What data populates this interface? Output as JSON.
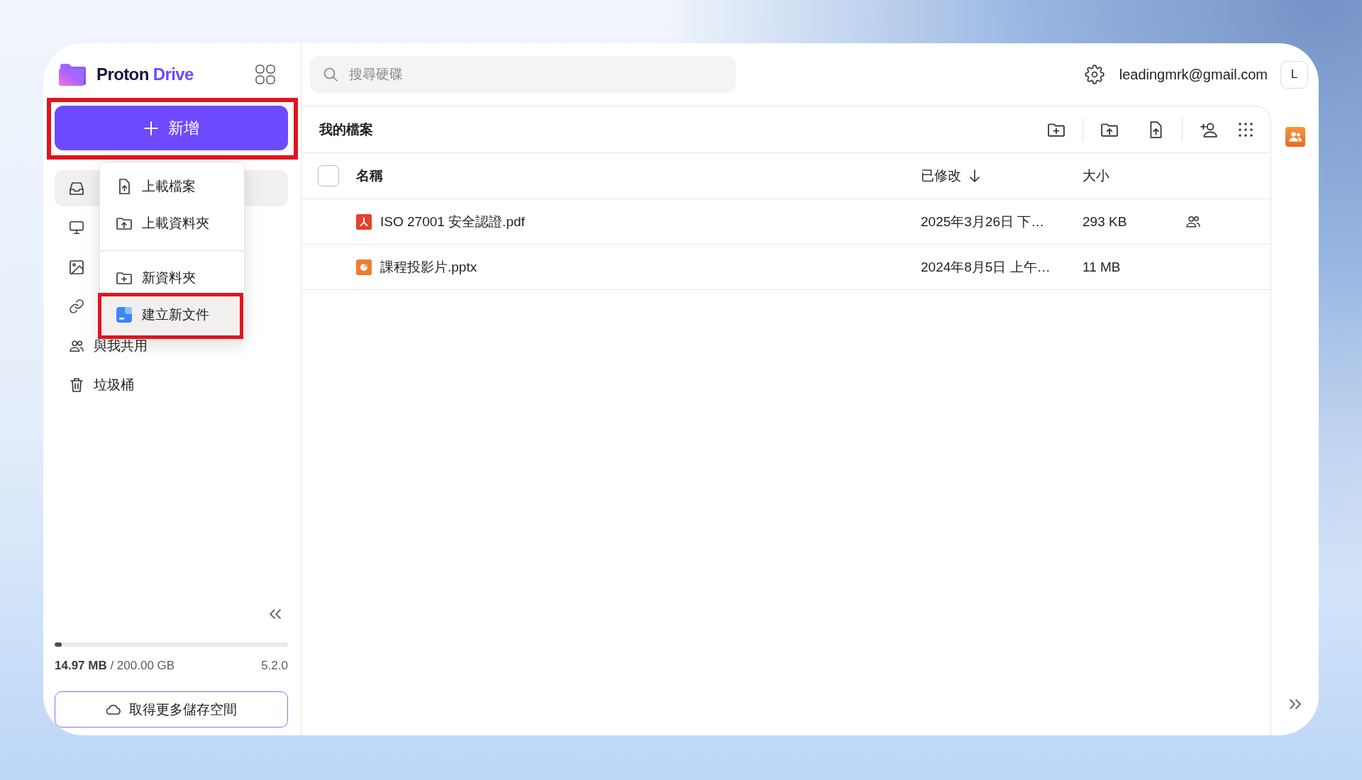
{
  "sidebar": {
    "logo": {
      "name": "Proton",
      "product": "Drive"
    },
    "new_button": {
      "label": "新增",
      "annotated": true
    },
    "new_menu": {
      "groups": [
        [
          {
            "kind": "upload-file",
            "label": "上載檔案",
            "hovered": false,
            "annotated": false
          },
          {
            "kind": "upload-folder",
            "label": "上載資料夾",
            "hovered": false,
            "annotated": false
          }
        ],
        [
          {
            "kind": "new-folder",
            "label": "新資料夾",
            "hovered": false,
            "annotated": false
          },
          {
            "kind": "new-document",
            "label": "建立新文件",
            "hovered": true,
            "annotated": true
          }
        ]
      ]
    },
    "nav": [
      {
        "kind": "my-files",
        "selected": true
      },
      {
        "kind": "computers",
        "selected": false
      },
      {
        "kind": "photos",
        "selected": false
      },
      {
        "kind": "shared-links",
        "selected": false
      },
      {
        "kind": "shared-with-me",
        "label": "與我共用",
        "selected": false
      },
      {
        "kind": "trash",
        "label": "垃圾桶",
        "selected": false
      }
    ],
    "storage": {
      "level": 0.03,
      "usage": "**14.97 MB** / 200.00 GB",
      "version": "5.2.0"
    },
    "upgrade_button": {
      "label": "取得更多儲存空間"
    }
  },
  "topbar": {
    "search": {
      "placeholder": "搜尋硬碟"
    },
    "account": {
      "email": "leadingmrk@gmail.com",
      "initial": "L"
    }
  },
  "files": {
    "title": "我的檔案",
    "select_all": {
      "checked": false
    },
    "columns": [
      {
        "label": "名稱",
        "sorted": false
      },
      {
        "label": "已修改",
        "sorted": true
      },
      {
        "label": "大小",
        "sorted": false
      }
    ],
    "rows": [
      {
        "kind": "pdf",
        "name": "ISO 27001 安全認證.pdf",
        "modified": "2025年3月26日 下…",
        "size": "293 KB",
        "shared": true
      },
      {
        "kind": "pptx",
        "name": "課程投影片.pptx",
        "modified": "2024年8月5日 上午…",
        "size": "11 MB",
        "shared": false
      }
    ]
  }
}
